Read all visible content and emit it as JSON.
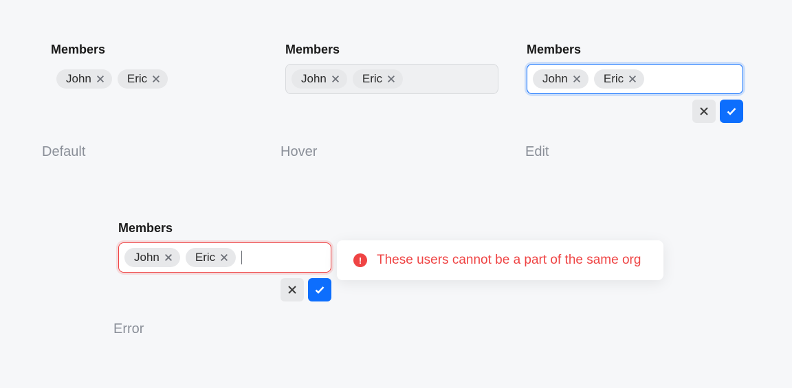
{
  "states": {
    "default": {
      "label": "Members",
      "stateLabel": "Default",
      "tags": [
        {
          "name": "John"
        },
        {
          "name": "Eric"
        }
      ]
    },
    "hover": {
      "label": "Members",
      "stateLabel": "Hover",
      "tags": [
        {
          "name": "John"
        },
        {
          "name": "Eric"
        }
      ]
    },
    "edit": {
      "label": "Members",
      "stateLabel": "Edit",
      "tags": [
        {
          "name": "John"
        },
        {
          "name": "Eric"
        }
      ]
    },
    "error": {
      "label": "Members",
      "stateLabel": "Error",
      "tags": [
        {
          "name": "John"
        },
        {
          "name": "Eric"
        }
      ],
      "message": "These users cannot be a part of the same org"
    }
  },
  "colors": {
    "accent": "#0d6efd",
    "error": "#ef4444",
    "tagBg": "#e7e8ea"
  }
}
